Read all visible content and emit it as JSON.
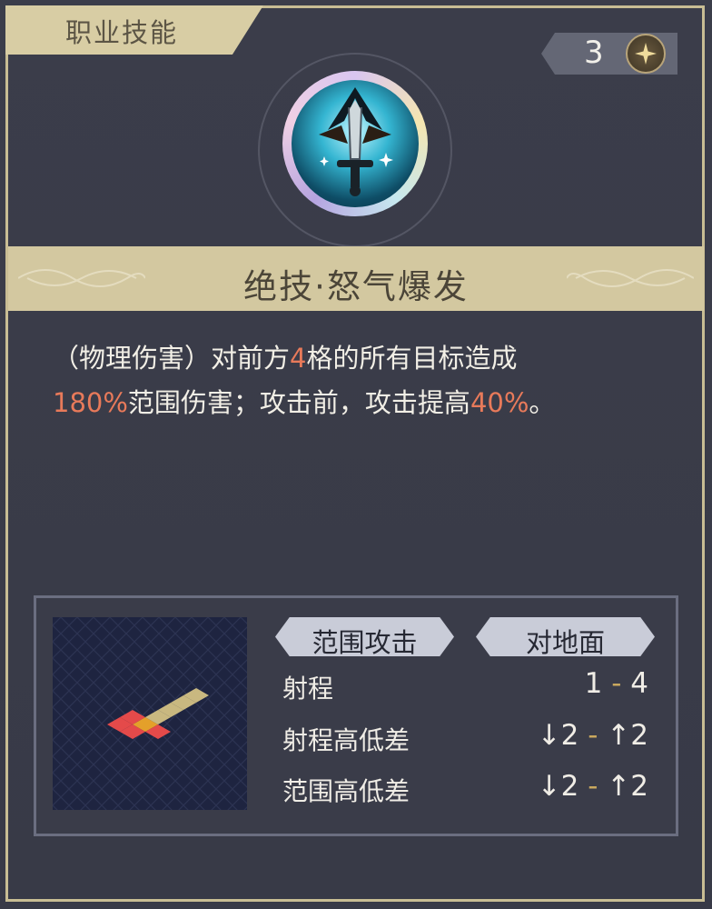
{
  "header": {
    "tab_label": "职业技能"
  },
  "cost": {
    "value": "3",
    "icon": "star-icon"
  },
  "skill": {
    "icon": "sword-emblem-icon",
    "title": "绝技·怒气爆发",
    "desc": {
      "p1": "（物理伤害）对前方",
      "n1": "4",
      "p2": "格的所有目标造成",
      "n2": "180%",
      "p3": "范围伤害；攻击前，攻击提高",
      "n3": "40%",
      "p4": "。"
    }
  },
  "badges": {
    "range_type": "范围攻击",
    "target_type": "对地面"
  },
  "stats": {
    "range": {
      "label": "射程",
      "min": "1",
      "sep": " - ",
      "max": "4"
    },
    "range_height": {
      "label": "射程高低差",
      "min": "↓2",
      "sep": " - ",
      "max": "↑2"
    },
    "area_height": {
      "label": "范围高低差",
      "min": "↓2",
      "sep": " - ",
      "max": "↑2"
    }
  },
  "colors": {
    "highlight": "#e87a5a",
    "gold": "#d3c8a0",
    "background": "#3a3c48"
  }
}
